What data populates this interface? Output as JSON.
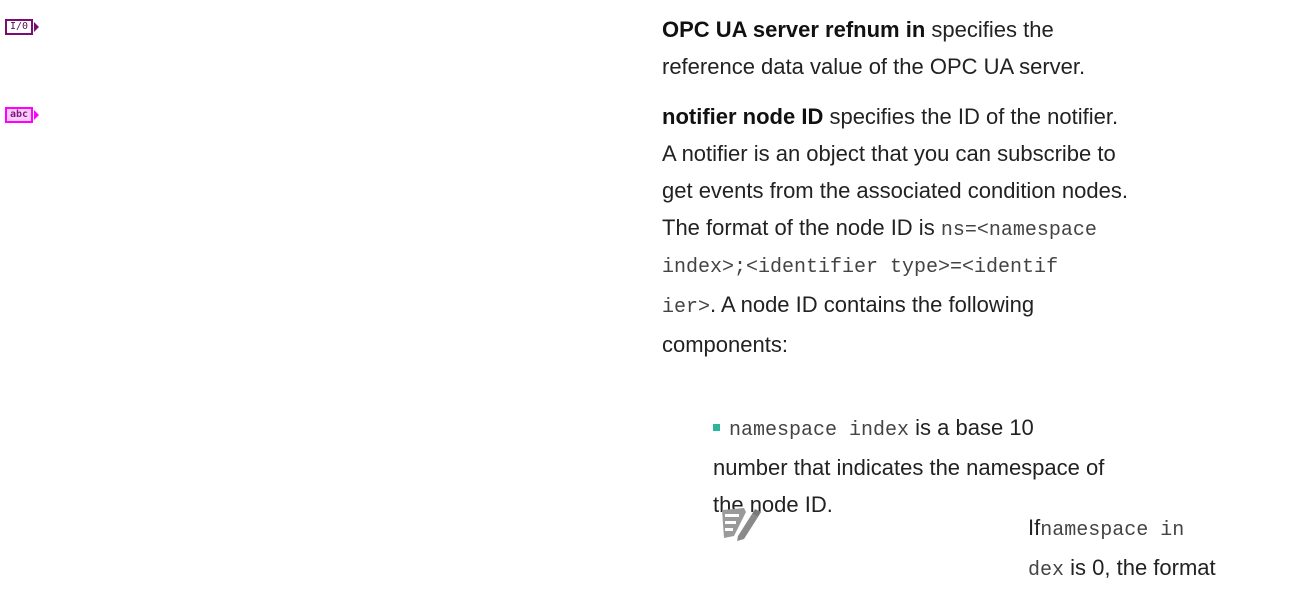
{
  "terminals": [
    {
      "label": "I/0",
      "kind": "refnum"
    },
    {
      "label": "abc",
      "kind": "string"
    }
  ],
  "param1": {
    "name": "OPC UA server refnum in",
    "line1_rest": "specifies the",
    "line2": "reference data value of the OPC UA server."
  },
  "param2": {
    "name": "notifier node ID",
    "line1_rest": "specifies the ID of the notifier.",
    "line2": "A notifier is an object that you can subscribe to",
    "line3": "get events from the associated condition nodes.",
    "line4_text": "The format of the node ID is",
    "line4_code": "ns=<namespace",
    "line5_code": "index>;<identifier type>=<identif",
    "line6_code": "ier>",
    "line6_text": ". A node ID contains the following",
    "line7": "components:"
  },
  "bullet1": {
    "code": "namespace index",
    "line1_rest": "is a base 10",
    "line2": "number that indicates the namespace of",
    "line3": "the node ID."
  },
  "note": {
    "icon": "note-pencil-icon",
    "prefix": "If",
    "code1": "namespace in",
    "code2": "dex",
    "line2_rest": "is 0, the format"
  }
}
